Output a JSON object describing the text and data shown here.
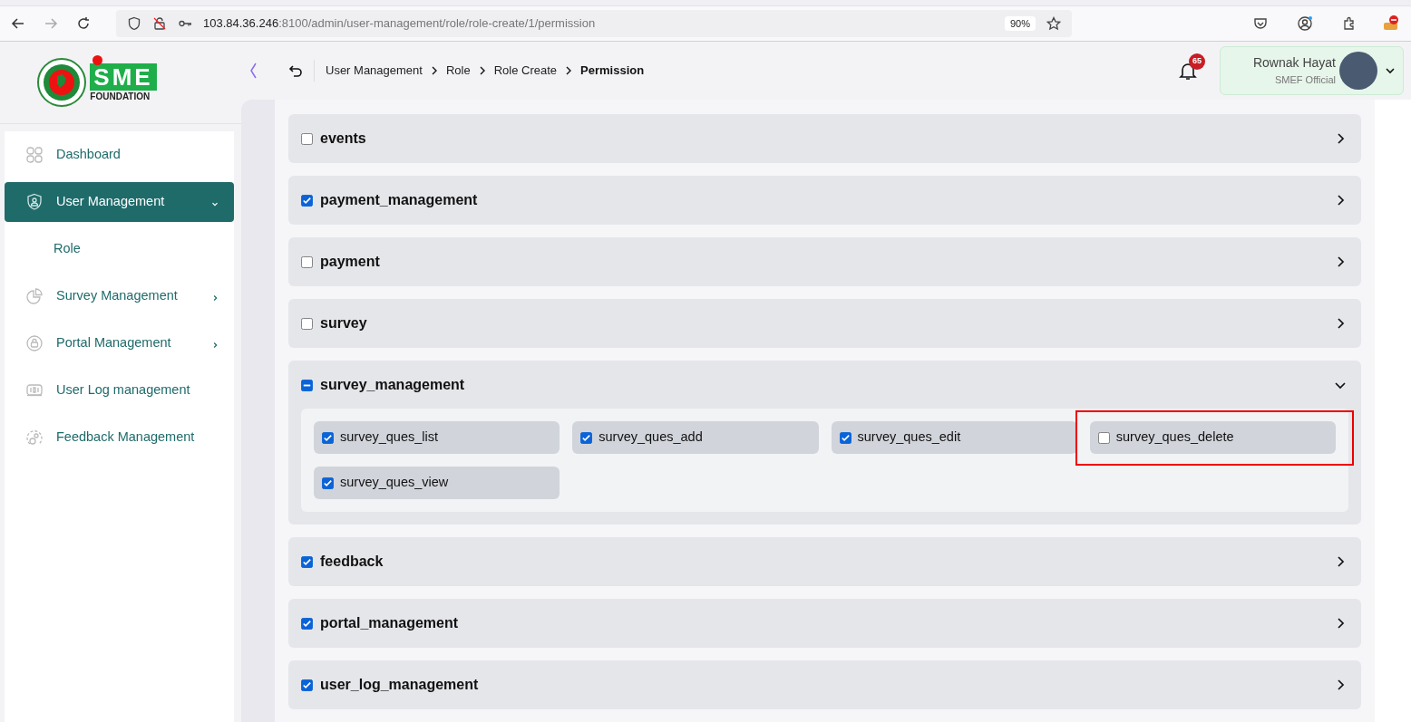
{
  "browser": {
    "url_host": "103.84.36.246",
    "url_path": ":8100/admin/user-management/role/role-create/1/permission",
    "zoom": "90%"
  },
  "logo": {
    "text": "SME",
    "subtitle": "FOUNDATION"
  },
  "sidebar": {
    "items": [
      {
        "label": "Dashboard",
        "kind": "grid",
        "selected": false
      },
      {
        "label": "User Management",
        "kind": "shield",
        "selected": true,
        "has_submenu": true,
        "expanded": true
      },
      {
        "label": "Role",
        "kind": "subitem",
        "selected": false
      },
      {
        "label": "Survey Management",
        "kind": "pie",
        "selected": false,
        "has_submenu": true,
        "expanded": false
      },
      {
        "label": "Portal Management",
        "kind": "lock",
        "selected": false,
        "has_submenu": true,
        "expanded": false
      },
      {
        "label": "User Log management",
        "kind": "log",
        "selected": false
      },
      {
        "label": "Feedback Management",
        "kind": "feedback",
        "selected": false
      }
    ]
  },
  "breadcrumb": [
    {
      "label": "User Management",
      "current": false
    },
    {
      "label": "Role",
      "current": false
    },
    {
      "label": "Role Create",
      "current": false
    },
    {
      "label": "Permission",
      "current": true
    }
  ],
  "notifications": {
    "count": "65"
  },
  "user": {
    "name": "Rownak Hayat",
    "role": "SMEF Official"
  },
  "groups": [
    {
      "name": "events",
      "checked": false,
      "expanded": false
    },
    {
      "name": "payment_management",
      "checked": true,
      "expanded": false
    },
    {
      "name": "payment",
      "checked": false,
      "expanded": false
    },
    {
      "name": "survey",
      "checked": false,
      "expanded": false
    },
    {
      "name": "survey_management",
      "checked": false,
      "partial": true,
      "expanded": true,
      "permissions": [
        {
          "name": "survey_ques_list",
          "checked": true,
          "highlighted": false
        },
        {
          "name": "survey_ques_add",
          "checked": true,
          "highlighted": false
        },
        {
          "name": "survey_ques_edit",
          "checked": true,
          "highlighted": false
        },
        {
          "name": "survey_ques_delete",
          "checked": false,
          "highlighted": true
        },
        {
          "name": "survey_ques_view",
          "checked": true,
          "highlighted": false
        }
      ]
    },
    {
      "name": "feedback",
      "checked": true,
      "expanded": false
    },
    {
      "name": "portal_management",
      "checked": true,
      "expanded": false
    },
    {
      "name": "user_log_management",
      "checked": true,
      "expanded": false
    }
  ]
}
